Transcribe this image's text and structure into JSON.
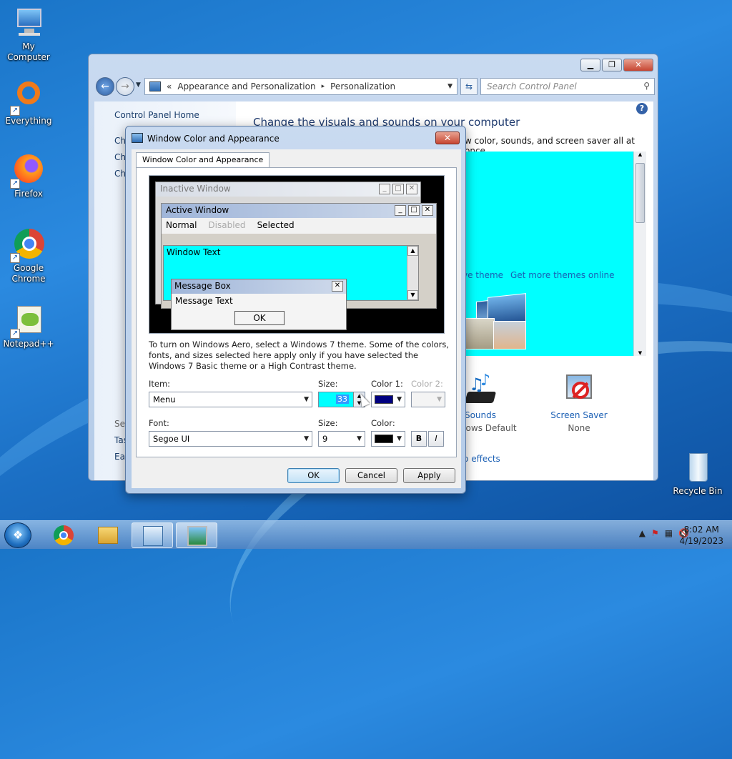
{
  "desktop": {
    "icons": [
      {
        "label": "My Computer"
      },
      {
        "label": "Everything"
      },
      {
        "label": "Firefox"
      },
      {
        "label": "Google Chrome"
      },
      {
        "label": "Notepad++"
      },
      {
        "label": "Recycle Bin"
      }
    ]
  },
  "control_panel": {
    "breadcrumb_prefix": "«",
    "breadcrumb_1": "Appearance and Personalization",
    "breadcrumb_sep": "▸",
    "breadcrumb_2": "Personalization",
    "search_placeholder": "Search Control Panel",
    "left_home": "Control Panel Home",
    "left_stubs": [
      "Ch",
      "Ch",
      "Ch",
      "See",
      "Tas",
      "Eas"
    ],
    "title": "Change the visuals and sounds on your computer",
    "subtitle": "w color, sounds, and screen saver all at once.",
    "save_theme": "Save theme",
    "more_themes": "Get more themes online",
    "aero_effects": "Aero effects",
    "sounds_label": "Sounds",
    "sounds_value": "Windows Default",
    "screensaver_label": "Screen Saver",
    "screensaver_value": "None",
    "theme_bg_color": "#00FFFF"
  },
  "dialog": {
    "title": "Window Color and Appearance",
    "tab_label": "Window Color and Appearance",
    "preview": {
      "inactive_title": "Inactive Window",
      "active_title": "Active Window",
      "menu_normal": "Normal",
      "menu_disabled": "Disabled",
      "menu_selected": "Selected",
      "window_text": "Window Text",
      "message_box_title": "Message Box",
      "message_text": "Message Text",
      "ok": "OK"
    },
    "info_text": "To turn on Windows Aero, select a Windows 7 theme.  Some of the colors, fonts, and sizes selected here apply only if you have selected the Windows 7 Basic theme or a High Contrast theme.",
    "item_label": "Item:",
    "item_value": "Menu",
    "size_label": "Size:",
    "size_value": "33",
    "color1_label": "Color 1:",
    "color1_value": "#000080",
    "color2_label": "Color 2:",
    "font_label": "Font:",
    "font_value": "Segoe UI",
    "font_size_label": "Size:",
    "font_size_value": "9",
    "font_color_label": "Color:",
    "font_color_value": "#000000",
    "bold_label": "B",
    "italic_label": "I",
    "ok_label": "OK",
    "cancel_label": "Cancel",
    "apply_label": "Apply"
  },
  "taskbar": {
    "clock_time": "8:02 AM",
    "clock_date": "4/19/2023"
  }
}
